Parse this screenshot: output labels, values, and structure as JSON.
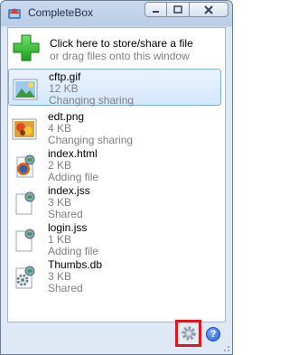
{
  "window": {
    "title": "CompleteBox"
  },
  "add": {
    "title": "Click here to store/share a file",
    "subtitle": "or drag files onto this window"
  },
  "files": [
    {
      "name": "cftp.gif",
      "size": "12 KB",
      "status": "Changing sharing",
      "icon": "image-file-icon",
      "selected": true
    },
    {
      "name": "edt.png",
      "size": "4 KB",
      "status": "Changing sharing",
      "icon": "image-file-icon"
    },
    {
      "name": "index.html",
      "size": "2 KB",
      "status": "Adding file",
      "icon": "firefox-html-file-icon"
    },
    {
      "name": "index.jss",
      "size": "3 KB",
      "status": "Shared",
      "icon": "blank-file-icon"
    },
    {
      "name": "login.jss",
      "size": "1 KB",
      "status": "Adding file",
      "icon": "blank-file-icon"
    },
    {
      "name": "Thumbs.db",
      "size": "3 KB",
      "status": "Shared",
      "icon": "settings-file-icon"
    }
  ],
  "bottom": {
    "help_label": "?"
  },
  "colors": {
    "highlight": "#e0181b",
    "selection": "#d5e7fb"
  }
}
